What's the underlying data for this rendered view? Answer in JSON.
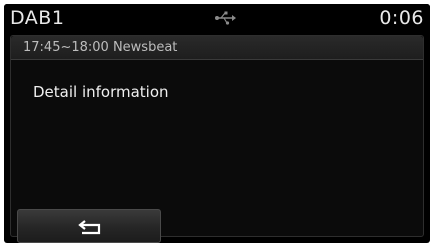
{
  "status_bar": {
    "title": "DAB1",
    "clock": "0:06",
    "usb_icon": "usb-icon"
  },
  "program": {
    "time_and_name": "17:45~18:00 Newsbeat"
  },
  "detail": {
    "label": "Detail information"
  },
  "back_button": {
    "icon": "back-arrow-icon"
  },
  "colors": {
    "background": "#000000",
    "text": "#f0f0f0",
    "header_bar": "#2a2a2a"
  }
}
